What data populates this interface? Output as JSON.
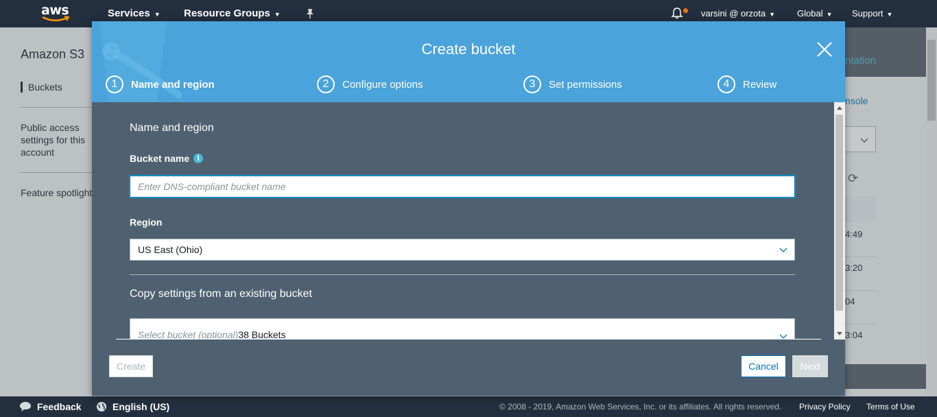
{
  "topnav": {
    "logo": "aws",
    "services": "Services",
    "resource_groups": "Resource Groups",
    "user": "varsini @ orzota",
    "region": "Global",
    "support": "Support"
  },
  "sidebar": {
    "title": "Amazon S3",
    "items": [
      {
        "label": "Buckets"
      },
      {
        "label": "Public access settings for this account"
      },
      {
        "label": "Feature spotlight"
      }
    ]
  },
  "background": {
    "doc_fragment": "ntation",
    "console_fragment": "nsole",
    "times": [
      "4:49",
      "3:20",
      "04",
      "3:04"
    ]
  },
  "modal": {
    "title": "Create bucket",
    "steps": [
      {
        "num": "1",
        "label": "Name and region",
        "active": true
      },
      {
        "num": "2",
        "label": "Configure options"
      },
      {
        "num": "3",
        "label": "Set permissions"
      },
      {
        "num": "4",
        "label": "Review"
      }
    ],
    "section_title": "Name and region",
    "bucket_name_label": "Bucket name",
    "bucket_name_placeholder": "Enter DNS-compliant bucket name",
    "bucket_name_value": "",
    "region_label": "Region",
    "region_value": "US East (Ohio)",
    "copy_title": "Copy settings from an existing bucket",
    "copy_placeholder": "Select bucket (optional)",
    "copy_count": "38 Buckets",
    "buttons": {
      "create": "Create",
      "cancel": "Cancel",
      "next": "Next"
    }
  },
  "footer": {
    "feedback": "Feedback",
    "language": "English (US)",
    "copyright": "© 2008 - 2019, Amazon Web Services, Inc. or its affiliates. All rights reserved.",
    "privacy": "Privacy Policy",
    "terms": "Terms of Use"
  },
  "colors": {
    "nav_bg": "#232f3e",
    "modal_header": "#4aa3da",
    "modal_body": "#4f6170",
    "accent_orange": "#ec7211",
    "link_blue": "#0073bb"
  }
}
